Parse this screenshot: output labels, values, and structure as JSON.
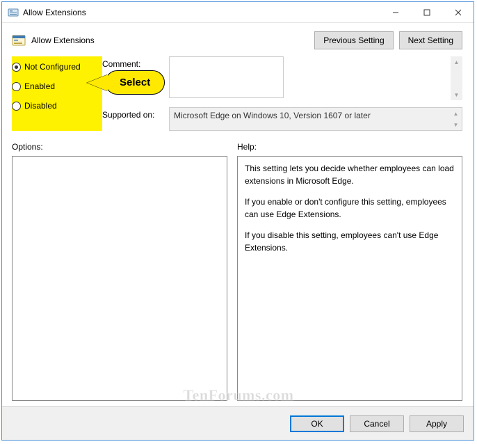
{
  "window": {
    "title": "Allow Extensions"
  },
  "header": {
    "title": "Allow Extensions",
    "previous": "Previous Setting",
    "next": "Next Setting"
  },
  "radios": {
    "not_configured": "Not Configured",
    "enabled": "Enabled",
    "disabled": "Disabled"
  },
  "callout": {
    "text": "Select"
  },
  "fields": {
    "comment_label": "Comment:",
    "comment_value": "",
    "supported_label": "Supported on:",
    "supported_value": "Microsoft Edge on Windows 10, Version 1607 or later"
  },
  "lower": {
    "options_label": "Options:",
    "help_label": "Help:",
    "help_p1": "This setting lets you decide whether employees can load extensions in Microsoft Edge.",
    "help_p2": "If you enable or don't configure this setting, employees can use Edge Extensions.",
    "help_p3": "If you disable this setting, employees can't use Edge Extensions."
  },
  "footer": {
    "ok": "OK",
    "cancel": "Cancel",
    "apply": "Apply"
  },
  "watermark": "TenForums.com"
}
